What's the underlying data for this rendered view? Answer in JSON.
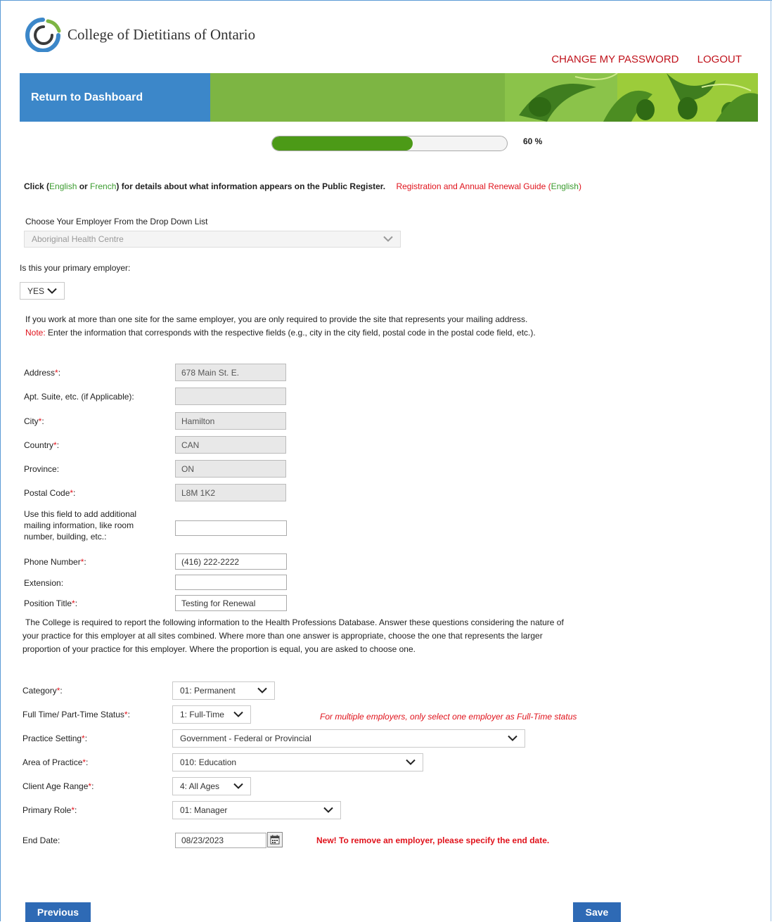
{
  "header": {
    "org_name": "College of Dietitians of Ontario",
    "links": [
      "CHANGE MY PASSWORD",
      "LOGOUT"
    ],
    "dashboard_label": "Return to Dashboard"
  },
  "progress": {
    "value": 60,
    "label": "60 %"
  },
  "register": {
    "prefix": "Click (",
    "english": "English",
    "or": " or ",
    "french": "French",
    "suffix": ") for details about what information appears on the Public Register.",
    "guide_text": "Registration and Annual Renewal Guide (",
    "guide_english": "English",
    "guide_close": ")"
  },
  "employer": {
    "label": "Choose Your Employer From the Drop Down List",
    "value": "Aboriginal Health Centre",
    "primary_label": "Is this your primary employer:",
    "primary_value": "YES"
  },
  "info": {
    "line1": "If you work at more than one site for the same employer, you are only required to provide the site that represents your mailing address.",
    "note_prefix": "Note:",
    "note_text": " Enter the information that corresponds with the respective fields (e.g., city in the city field, postal code in the postal code field, etc.)."
  },
  "address_fields": [
    {
      "label": "Address",
      "required": true,
      "value": "678 Main St. E."
    },
    {
      "label": "Apt. Suite, etc. (if Applicable):",
      "required": false,
      "value": ""
    },
    {
      "label": "City",
      "required": true,
      "value": "Hamilton"
    },
    {
      "label": "Country",
      "required": true,
      "value": "CAN"
    },
    {
      "label": "Province:",
      "required": false,
      "value": "ON"
    },
    {
      "label": "Postal Code",
      "required": true,
      "value": "L8M 1K2"
    }
  ],
  "mailing": {
    "label_lines": [
      "Use this field to add additional",
      "mailing information, like room",
      "number, building, etc.:"
    ],
    "value": ""
  },
  "phone": {
    "label": "Phone Number",
    "value": "(416) 222-2222"
  },
  "extension": {
    "label": "Extension:",
    "value": ""
  },
  "position": {
    "label": "Position Title",
    "value": "Testing for Renewal"
  },
  "hpd_text": {
    "line1": "The College is required to report the following information to the Health Professions Database. Answer these questions considering the nature of",
    "line2": "your practice for this employer at all sites combined. Where more than one answer is appropriate, choose the one that represents the larger",
    "line3": "proportion of your practice for this employer. Where the proportion is equal, you are asked to choose one."
  },
  "selects": {
    "category": {
      "label": "Category",
      "value": "01: Permanent"
    },
    "fulltime": {
      "label": "Full Time/ Part-Time Status",
      "value": "1: Full-Time"
    },
    "fulltime_note": "For multiple employers, only select one employer as Full-Time status",
    "setting": {
      "label": "Practice Setting",
      "value": "Government - Federal or Provincial"
    },
    "area": {
      "label": "Area of Practice",
      "value": "010: Education"
    },
    "age": {
      "label": "Client Age Range",
      "value": "4: All Ages"
    },
    "role": {
      "label": "Primary Role",
      "value": "01: Manager"
    }
  },
  "end_date": {
    "label": "End Date:",
    "value": "08/23/2023",
    "note": "New! To remove an employer, please specify the end date."
  },
  "buttons": {
    "previous": "Previous",
    "save": "Save"
  },
  "colors": {
    "accent_blue": "#3c87c9",
    "banner_green": "#7db543",
    "required_red": "#e0121b",
    "progress_green": "#4c9a17"
  },
  "req_mark": "*",
  "colon": ":"
}
